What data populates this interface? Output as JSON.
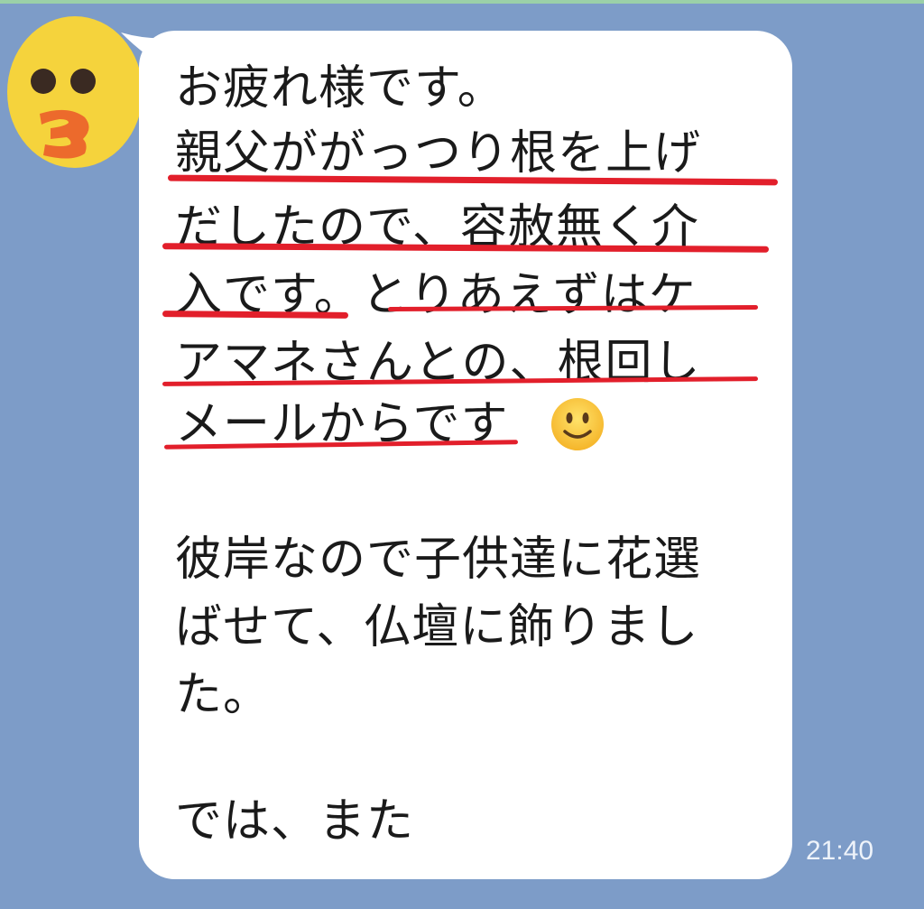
{
  "message": {
    "lines": [
      "お疲れ様です。",
      "親父ががっつり根を上げ",
      "だしたので、容赦無く介",
      "入です。とりあえずはケ",
      "アマネさんとの、根回し",
      "メールからです",
      "彼岸なので子供達に花選",
      "ばせて、仏壇に飾りまし",
      "た。",
      "では、また"
    ],
    "emoji": "slightly-smiling-face"
  },
  "timestamp": "21:40",
  "colors": {
    "background": "#7d9cc8",
    "bubble": "#ffffff",
    "underline": "#e21f2b",
    "avatar": "#f5d33c",
    "avatar_mouth": "#ec6a2c"
  },
  "icons": {
    "avatar": "sally-avatar-icon"
  }
}
